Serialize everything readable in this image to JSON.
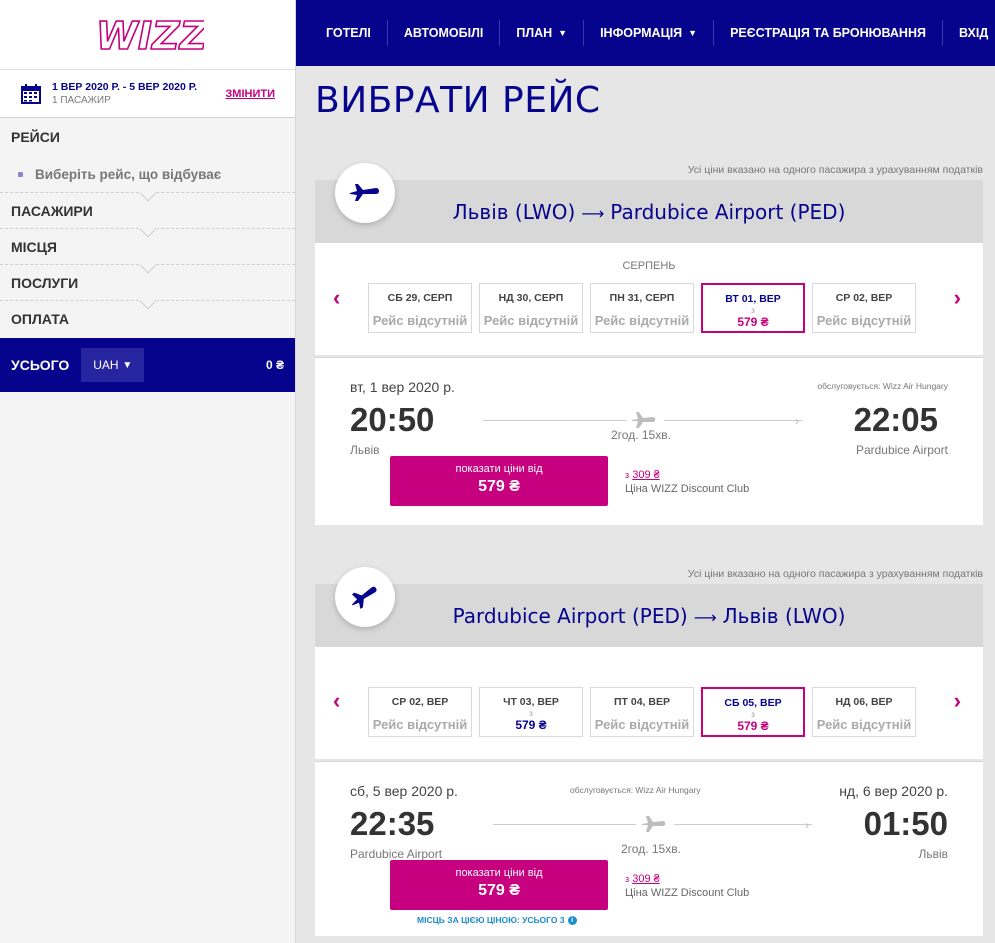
{
  "logo": "WIZZ",
  "trip": {
    "dates": "1 ВЕР 2020 Р. - 5 ВЕР 2020 Р.",
    "passengers": "1 ПАСАЖИР",
    "change": "ЗМІНИТИ"
  },
  "nav_sections": {
    "flights": "РЕЙСИ",
    "flights_sub": "Виберіть рейс, що відбуває",
    "passengers": "ПАСАЖИРИ",
    "seats": "МІСЦЯ",
    "services": "ПОСЛУГИ",
    "payment": "ОПЛАТА"
  },
  "total": {
    "label": "УСЬОГО",
    "currency": "UAH",
    "amount": "0 ₴"
  },
  "topnav": {
    "hotels": "ГОТЕЛІ",
    "cars": "АВТОМОБІЛІ",
    "plan": "ПЛАН",
    "info": "ІНФОРМАЦІЯ",
    "checkin": "РЕЄСТРАЦІЯ ТА БРОНЮВАННЯ",
    "login": "ВХІД"
  },
  "page_title": "ВИБРАТИ РЕЙС",
  "outbound": {
    "note": "Усі ціни вказано на одного пасажира з урахуванням податків",
    "from": "Львів (LWO)",
    "to": "Pardubice Airport (PED)",
    "month": "СЕРПЕНЬ",
    "days": [
      {
        "label": "СБ 29, СЕРП",
        "status": "Рейс відсутній"
      },
      {
        "label": "НД 30, СЕРП",
        "status": "Рейс відсутній"
      },
      {
        "label": "ПН 31, СЕРП",
        "status": "Рейс відсутній"
      },
      {
        "label": "ВТ 01, ВЕР",
        "from": "з",
        "price": "579 ₴"
      },
      {
        "label": "СР 02, ВЕР",
        "status": "Рейс відсутній"
      }
    ],
    "date": "вт, 1 вер 2020 р.",
    "operator": "обслуговується: Wizz Air Hungary",
    "dep_time": "20:50",
    "dep_city": "Львів",
    "duration": "2год. 15хв.",
    "arr_time": "22:05",
    "arr_city": "Pardubice Airport",
    "btn_label": "показати ціни від",
    "btn_price": "579 ₴",
    "club_from": "з",
    "club_price": "309 ₴",
    "club_label": "Ціна WIZZ Discount Club"
  },
  "inbound": {
    "note": "Усі ціни вказано на одного пасажира з урахуванням податків",
    "from": "Pardubice Airport (PED)",
    "to": "Львів (LWO)",
    "days": [
      {
        "label": "СР 02, ВЕР",
        "status": "Рейс відсутній"
      },
      {
        "label": "ЧТ 03, ВЕР",
        "from": "з",
        "price": "579 ₴"
      },
      {
        "label": "ПТ 04, ВЕР",
        "status": "Рейс відсутній"
      },
      {
        "label": "СБ 05, ВЕР",
        "from": "з",
        "price": "579 ₴"
      },
      {
        "label": "НД 06, ВЕР",
        "status": "Рейс відсутній"
      }
    ],
    "date": "сб, 5 вер 2020 р.",
    "arr_date": "нд, 6 вер 2020 р.",
    "operator": "обслуговується: Wizz Air Hungary",
    "dep_time": "22:35",
    "dep_city": "Pardubice Airport",
    "duration": "2год. 15хв.",
    "arr_time": "01:50",
    "arr_city": "Львів",
    "btn_label": "показати ціни від",
    "btn_price": "579 ₴",
    "club_from": "з",
    "club_price": "309 ₴",
    "club_label": "Ціна WIZZ Discount Club",
    "seat_note": "МІСЦЬ ЗА ЦІЄЮ ЦІНОЮ: УСЬОГО 3"
  },
  "colors": {
    "brand_blue": "#06038d",
    "brand_pink": "#c6007e"
  }
}
